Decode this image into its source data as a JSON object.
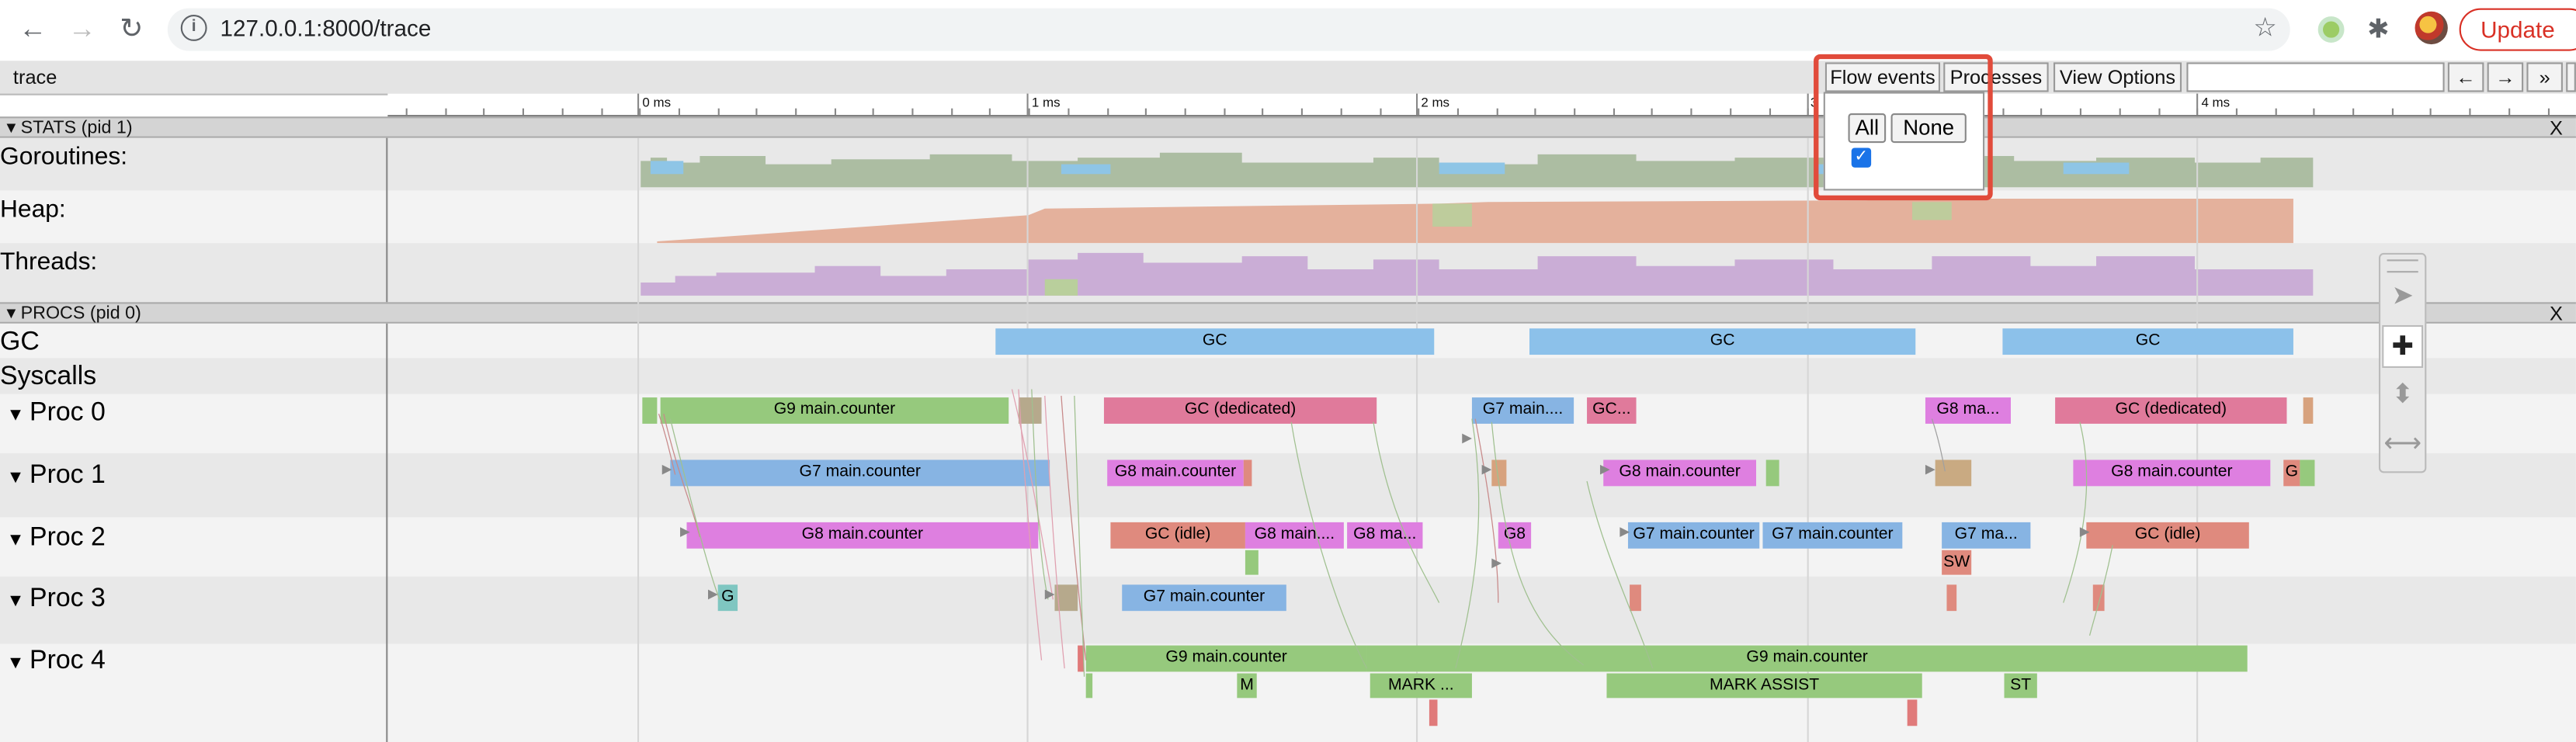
{
  "browser": {
    "url": "127.0.0.1:8000/trace",
    "update_label": "Update"
  },
  "toolbar": {
    "title": "trace",
    "buttons": [
      "Flow events",
      "Processes",
      "View Options"
    ],
    "nav": [
      "←",
      "→",
      "»"
    ]
  },
  "flow_popup": {
    "all_label": "All",
    "none_label": "None",
    "checked": true
  },
  "ruler": {
    "labels": [
      "0 ms",
      "1 ms",
      "2 ms",
      "3",
      "4 ms"
    ]
  },
  "sections": {
    "stats": {
      "title": "STATS (pid 1)",
      "close": "X",
      "rows": [
        "Goroutines:",
        "Heap:",
        "Threads:"
      ]
    },
    "procs": {
      "title": "PROCS (pid 0)",
      "close": "X"
    }
  },
  "procs": {
    "gc_label": "GC",
    "syscalls_label": "Syscalls",
    "proc_labels": [
      "Proc 0",
      "Proc 1",
      "Proc 2",
      "Proc 3",
      "Proc 4"
    ],
    "gc_slices": [
      "GC",
      "GC",
      "GC"
    ],
    "proc0": [
      "G9 main.counter",
      "GC (dedicated)",
      "G7 main....",
      "GC...",
      "G8 ma...",
      "GC (dedicated)"
    ],
    "proc1": [
      "G7 main.counter",
      "G8 main.counter",
      "G8 main.counter",
      "G8 main.counter",
      "G"
    ],
    "proc2": [
      "G8 main.counter",
      "GC (idle)",
      "G8 main....",
      "G8 ma...",
      "G8",
      "G7 main.counter",
      "G7 main.counter",
      "G7 ma...",
      "GC (idle)",
      "SW"
    ],
    "proc3": [
      "G",
      "G7 main.counter"
    ],
    "proc4": [
      "G9 main.counter",
      "G9 main.counter",
      "M",
      "MARK ...",
      "MARK ASSIST",
      "ST"
    ]
  },
  "colors": {
    "green": "#96c97d",
    "blue": "#87b4e3",
    "magenta": "#de7fe0",
    "pink": "#e07a9b",
    "salmon": "#df8a7e",
    "gc_blue": "#8cc1ea",
    "popup_highlight": "#e14b3b"
  },
  "icons": [
    "back-arrow-icon",
    "forward-arrow-icon",
    "reload-icon",
    "info-icon",
    "star-icon",
    "extension-puzzle-icon",
    "selection-cursor-icon",
    "pan-icon",
    "zoom-icon",
    "timing-icon"
  ]
}
